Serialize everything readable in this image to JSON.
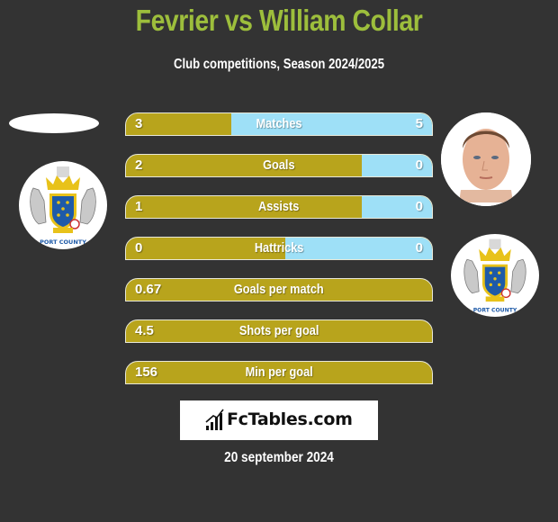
{
  "header": {
    "title": "Fevrier vs William Collar",
    "subtitle": "Club competitions, Season 2024/2025"
  },
  "players": {
    "left": {
      "name": "Fevrier",
      "club_badge": "stockport-county-crest",
      "club_text": "PORT COUNT"
    },
    "right": {
      "name": "William Collar",
      "photo": "player-photo",
      "club_badge": "stockport-county-crest",
      "club_text": "PORT COUNT"
    }
  },
  "colors": {
    "left_bar": "#b8a41c",
    "right_bar": "#9ee0f7",
    "title": "#9dbe3c",
    "background": "#333333"
  },
  "stats": [
    {
      "label": "Matches",
      "left": "3",
      "right": "5",
      "left_fraction": 0.345
    },
    {
      "label": "Goals",
      "left": "2",
      "right": "0",
      "left_fraction": 0.77
    },
    {
      "label": "Assists",
      "left": "1",
      "right": "0",
      "left_fraction": 0.77
    },
    {
      "label": "Hattricks",
      "left": "0",
      "right": "0",
      "left_fraction": 0.52
    },
    {
      "label": "Goals per match",
      "left": "0.67",
      "right": null,
      "left_fraction": 1.0
    },
    {
      "label": "Shots per goal",
      "left": "4.5",
      "right": null,
      "left_fraction": 1.0
    },
    {
      "label": "Min per goal",
      "left": "156",
      "right": null,
      "left_fraction": 1.0
    }
  ],
  "brand": {
    "text": "FcTables.com",
    "icon": "bar-chart-icon"
  },
  "date": "20 september 2024"
}
